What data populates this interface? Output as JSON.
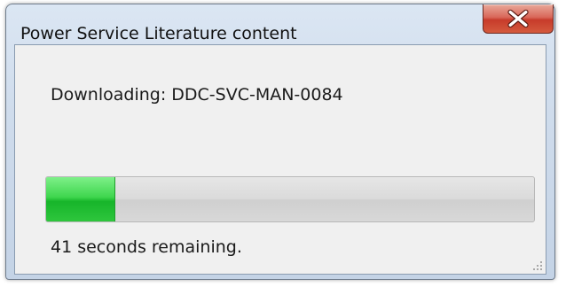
{
  "window": {
    "title": "Power Service Literature content"
  },
  "close_button": {
    "icon": "close-icon"
  },
  "status": {
    "downloading_text": "Downloading: DDC-SVC-MAN-0084",
    "remaining_text": "41 seconds remaining."
  },
  "progress": {
    "fraction": 0.14
  },
  "colors": {
    "progress_fill": "#2ec63d",
    "close_button": "#c73b2a"
  }
}
